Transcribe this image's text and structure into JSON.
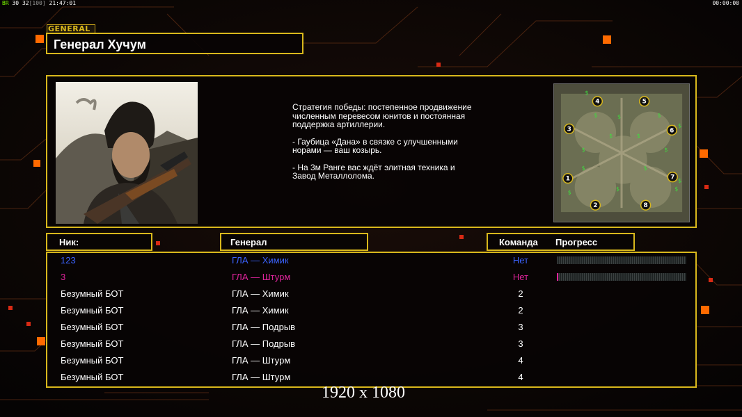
{
  "hud": {
    "fps_label": "BR",
    "fps": "30",
    "avg": "32",
    "max": "[100]",
    "clock": "21:47:01",
    "timer": "00:00:00"
  },
  "screen_tag": "GENERAL",
  "general": {
    "name": "Генерал Хучум",
    "strategy": [
      "Стратегия победы: постепенное продвижение численным перевесом юнитов и постоянная поддержка артиллерии.",
      "- Гаубица «Дана» в связке с улучшенными норами — ваш козырь.",
      "- На 3м Ранге вас ждёт элитная техника и Завод Металлолома."
    ]
  },
  "minimap": {
    "start_positions": [
      "1",
      "2",
      "3",
      "4",
      "5",
      "6",
      "7",
      "8"
    ],
    "icons": [
      "supply-dollar-icon",
      "oil-derrick-icon"
    ]
  },
  "headers": {
    "nick": "Ник:",
    "general": "Генерал",
    "team": "Команда",
    "progress": "Прогресс"
  },
  "players": [
    {
      "nick": "123",
      "general": "ГЛА — Химик",
      "team": "Нет",
      "color": "#3b63ff",
      "progress": 0.0,
      "show_progress": true
    },
    {
      "nick": "3",
      "general": "ГЛА — Штурм",
      "team": "Нет",
      "color": "#e0249c",
      "progress": 0.01,
      "show_progress": true
    },
    {
      "nick": "Безумный БОТ",
      "general": "ГЛА — Химик",
      "team": "2",
      "color": "#ffffff",
      "show_progress": false
    },
    {
      "nick": "Безумный БОТ",
      "general": "ГЛА — Химик",
      "team": "2",
      "color": "#ffffff",
      "show_progress": false
    },
    {
      "nick": "Безумный БОТ",
      "general": "ГЛА — Подрыв",
      "team": "3",
      "color": "#ffffff",
      "show_progress": false
    },
    {
      "nick": "Безумный БОТ",
      "general": "ГЛА — Подрыв",
      "team": "3",
      "color": "#ffffff",
      "show_progress": false
    },
    {
      "nick": "Безумный БОТ",
      "general": "ГЛА — Штурм",
      "team": "4",
      "color": "#ffffff",
      "show_progress": false
    },
    {
      "nick": "Безумный БОТ",
      "general": "ГЛА — Штурм",
      "team": "4",
      "color": "#ffffff",
      "show_progress": false
    }
  ],
  "resolution_label": "1920 x 1080",
  "colors": {
    "frame": "#d9b81c",
    "accent_orange": "#ff6a00",
    "background": "#0a0606"
  }
}
